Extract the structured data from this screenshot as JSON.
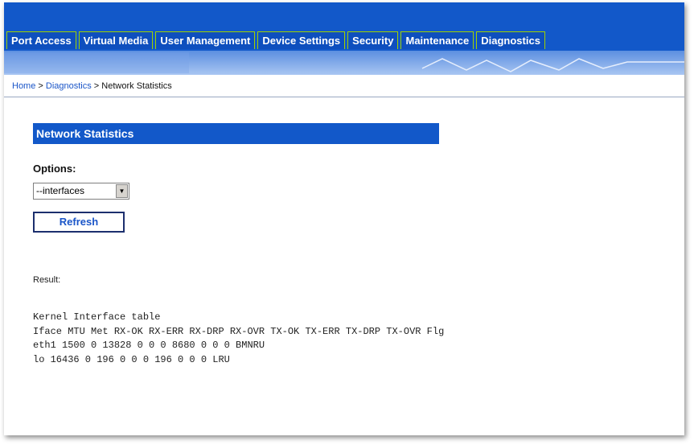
{
  "nav": {
    "tabs": [
      {
        "label": "Port Access"
      },
      {
        "label": "Virtual Media"
      },
      {
        "label": "User Management"
      },
      {
        "label": "Device Settings"
      },
      {
        "label": "Security"
      },
      {
        "label": "Maintenance"
      },
      {
        "label": "Diagnostics"
      }
    ]
  },
  "breadcrumb": {
    "home": "Home",
    "sep1": " > ",
    "section": "Diagnostics",
    "sep2": " > ",
    "current": "Network Statistics"
  },
  "main": {
    "title": "Network Statistics",
    "options_label": "Options:",
    "options_selected": "--interfaces",
    "refresh_label": "Refresh",
    "result_label": "Result:",
    "result_lines": [
      "Kernel Interface table",
      "Iface MTU Met RX-OK RX-ERR RX-DRP RX-OVR TX-OK TX-ERR TX-DRP TX-OVR Flg",
      "eth1 1500 0 13828 0 0 0 8680 0 0 0 BMNRU",
      "lo 16436 0 196 0 0 0 196 0 0 0 LRU"
    ]
  },
  "colors": {
    "header_blue": "#1258c9",
    "tab_border": "#9fd100",
    "link_blue": "#1a55c8"
  }
}
